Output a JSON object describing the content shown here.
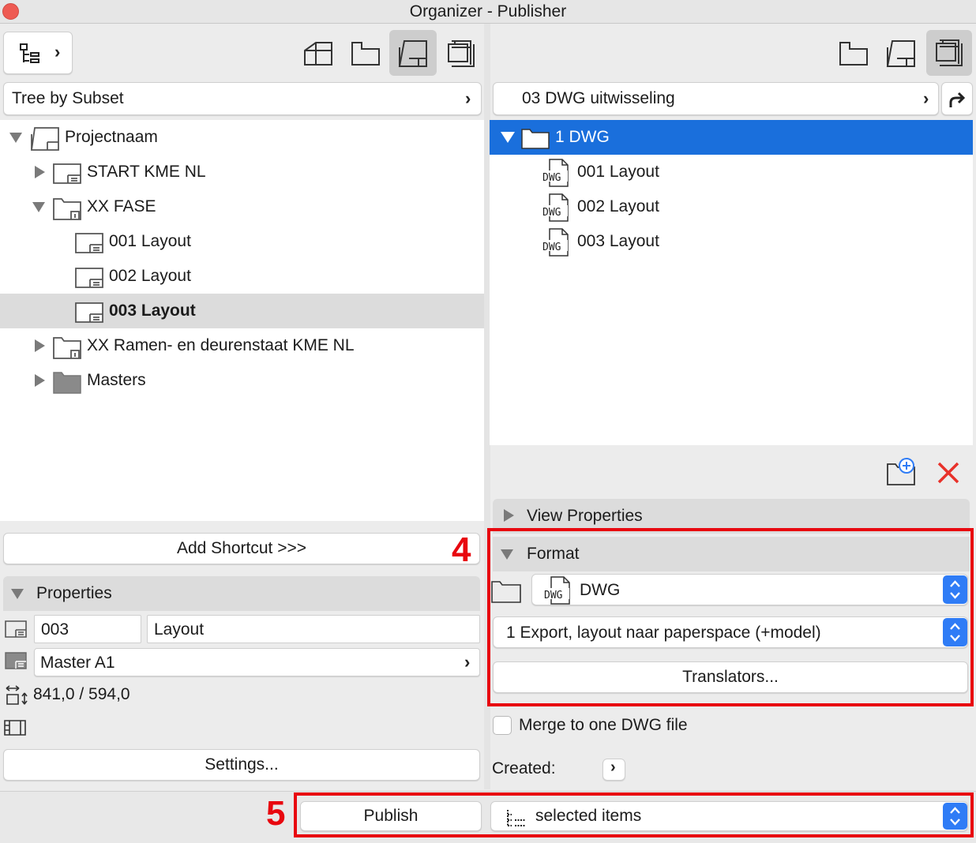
{
  "window": {
    "title": "Organizer - Publisher"
  },
  "left": {
    "view_selector": "Tree by Subset",
    "tree": {
      "root": "Projectnaam",
      "items": [
        "START KME NL",
        "XX FASE",
        "001 Layout",
        "002 Layout",
        "003 Layout",
        "XX Ramen- en deurenstaat KME NL",
        "Masters"
      ]
    },
    "add_shortcut_label": "Add Shortcut >>>",
    "properties": {
      "header": "Properties",
      "id_value": "003",
      "name_value": "Layout",
      "master_value": "Master A1",
      "size_value": "841,0 / 594,0",
      "settings_label": "Settings..."
    }
  },
  "right": {
    "publisher_set": "03 DWG uitwisseling",
    "tree": {
      "root": "1 DWG",
      "items": [
        "001 Layout",
        "002 Layout",
        "003 Layout"
      ]
    },
    "view_properties_header": "View Properties",
    "format": {
      "header": "Format",
      "file_type": "DWG",
      "translator": "1 Export, layout naar paperspace (+model)",
      "translators_button": "Translators..."
    },
    "merge_label": "Merge to one DWG file",
    "created_label": "Created:"
  },
  "bottom": {
    "publish_label": "Publish",
    "publish_scope": "selected items"
  },
  "annotations": {
    "four": "4",
    "five": "5"
  },
  "icons": {
    "dwg_file": "DWG"
  },
  "colors": {
    "selection": "#1a6fdc",
    "highlight_red": "#e8070f",
    "stepper_blue": "#2f7cf6"
  }
}
